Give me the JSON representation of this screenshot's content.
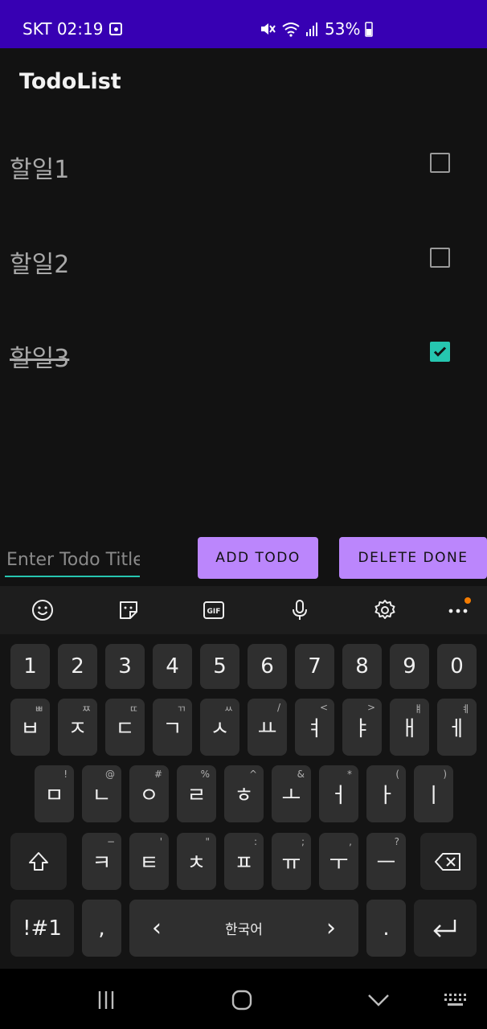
{
  "status_bar": {
    "carrier_time": "SKT 02:19",
    "battery": "53%"
  },
  "app": {
    "title": "TodoList"
  },
  "todos": [
    {
      "label": "할일1",
      "done": false
    },
    {
      "label": "할일2",
      "done": false
    },
    {
      "label": "할일3",
      "done": true
    }
  ],
  "form": {
    "input_placeholder": "Enter Todo Title",
    "add_label": "ADD TODO",
    "delete_label": "DELETE DONE"
  },
  "keyboard": {
    "toolbar": [
      "emoji-icon",
      "sticker-icon",
      "gif-icon",
      "mic-icon",
      "settings-icon",
      "more-icon"
    ],
    "gif_label": "GIF",
    "row_numbers": [
      "1",
      "2",
      "3",
      "4",
      "5",
      "6",
      "7",
      "8",
      "9",
      "0"
    ],
    "row1": [
      {
        "k": "ㅂ",
        "s": "ㅃ"
      },
      {
        "k": "ㅈ",
        "s": "ㅉ"
      },
      {
        "k": "ㄷ",
        "s": "ㄸ"
      },
      {
        "k": "ㄱ",
        "s": "ㄲ"
      },
      {
        "k": "ㅅ",
        "s": "ㅆ"
      },
      {
        "k": "ㅛ",
        "s": "/"
      },
      {
        "k": "ㅕ",
        "s": "<"
      },
      {
        "k": "ㅑ",
        "s": ">"
      },
      {
        "k": "ㅐ",
        "s": "ㅒ"
      },
      {
        "k": "ㅔ",
        "s": "ㅖ"
      }
    ],
    "row2": [
      {
        "k": "ㅁ",
        "s": "!"
      },
      {
        "k": "ㄴ",
        "s": "@"
      },
      {
        "k": "ㅇ",
        "s": "#"
      },
      {
        "k": "ㄹ",
        "s": "%"
      },
      {
        "k": "ㅎ",
        "s": "^"
      },
      {
        "k": "ㅗ",
        "s": "&"
      },
      {
        "k": "ㅓ",
        "s": "*"
      },
      {
        "k": "ㅏ",
        "s": "("
      },
      {
        "k": "ㅣ",
        "s": ")"
      }
    ],
    "row3": [
      {
        "k": "ㅋ",
        "s": "−"
      },
      {
        "k": "ㅌ",
        "s": "'"
      },
      {
        "k": "ㅊ",
        "s": "\""
      },
      {
        "k": "ㅍ",
        "s": ":"
      },
      {
        "k": "ㅠ",
        "s": ";"
      },
      {
        "k": "ㅜ",
        "s": ","
      },
      {
        "k": "ㅡ",
        "s": "?"
      }
    ],
    "symbols_label": "!#1",
    "comma_label": ",",
    "space_label": "한국어",
    "space_left_arrow": "‹",
    "space_right_arrow": "›",
    "period_label": "."
  },
  "colors": {
    "status_bar": "#3700b3",
    "accent": "#26c6b0",
    "button": "#bb86fc"
  }
}
